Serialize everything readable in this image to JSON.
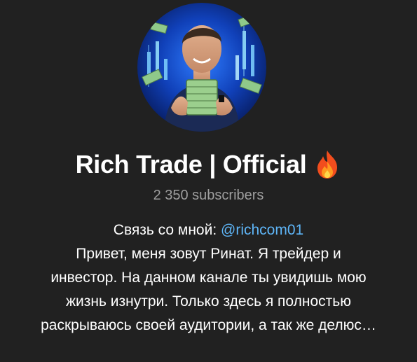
{
  "channel": {
    "title": "Rich Trade | Official",
    "title_emoji_icon": "fire-icon",
    "subscribers": "2 350 subscribers",
    "avatar_icon": "channel-avatar-photo"
  },
  "description": {
    "contact_prefix": "Связь со мной: ",
    "contact_mention": "@richcom01",
    "lines": [
      "Привет, меня зовут Ринат. Я трейдер и",
      "инвестор. На данном канале ты увидишь мою",
      "жизнь изнутри. Только здесь я полностью",
      "раскрываюсь своей аудитории, а так же делюс…"
    ]
  },
  "colors": {
    "background": "#212121",
    "text": "#ffffff",
    "muted": "#9e9e9e",
    "link": "#5eb5f7"
  }
}
